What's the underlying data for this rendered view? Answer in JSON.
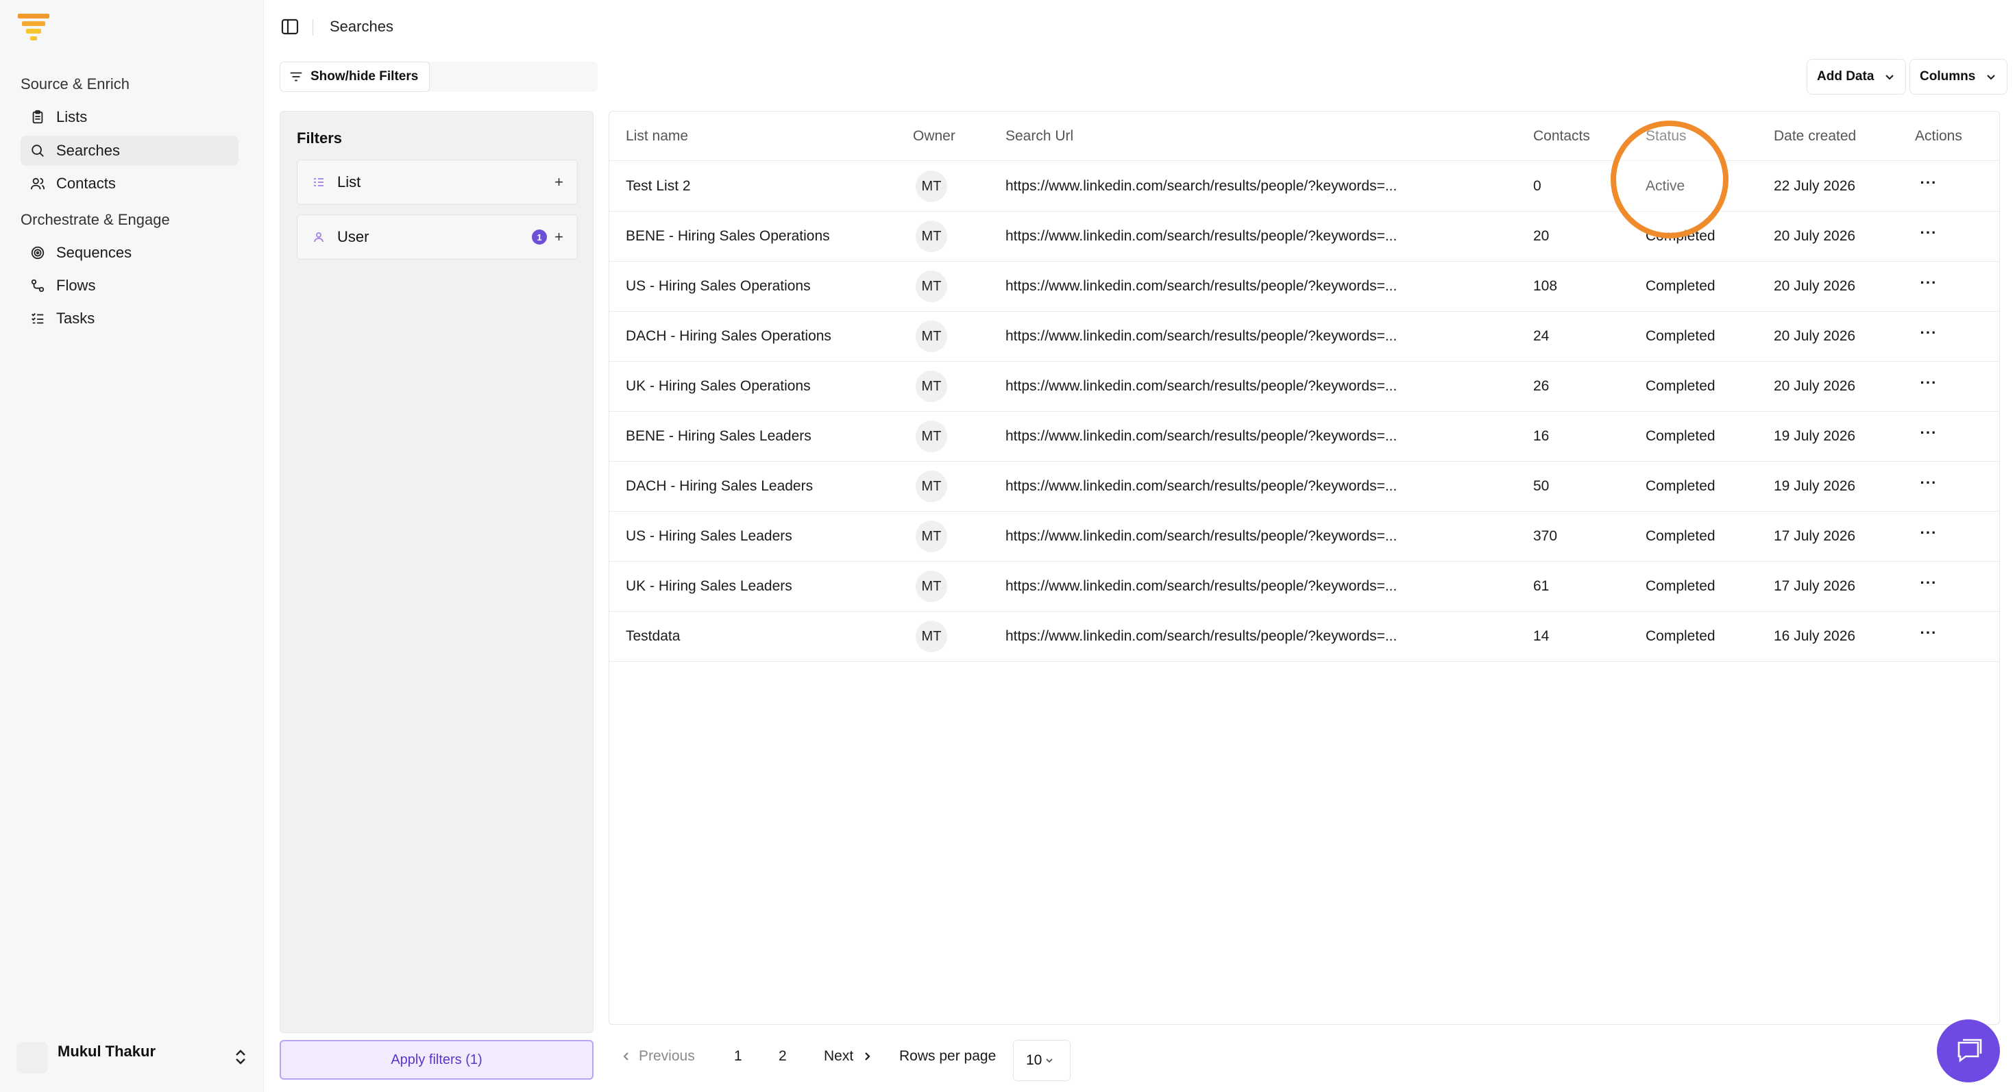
{
  "breadcrumb": {
    "title": "Searches"
  },
  "sidebar": {
    "sections": [
      {
        "title": "Source & Enrich"
      },
      {
        "title": "Orchestrate & Engage"
      }
    ],
    "items": [
      {
        "label": "Lists",
        "icon": "clipboard-icon"
      },
      {
        "label": "Searches",
        "icon": "search-icon",
        "active": true
      },
      {
        "label": "Contacts",
        "icon": "users-icon"
      },
      {
        "label": "Sequences",
        "icon": "target-icon"
      },
      {
        "label": "Flows",
        "icon": "flow-icon"
      },
      {
        "label": "Tasks",
        "icon": "tasks-icon"
      }
    ],
    "user": {
      "name": "Mukul Thakur"
    }
  },
  "toolbar": {
    "show_hide_filters": "Show/hide Filters",
    "add_data": "Add Data",
    "columns": "Columns"
  },
  "filters": {
    "title": "Filters",
    "items": [
      {
        "label": "List",
        "count": ""
      },
      {
        "label": "User",
        "count": "1"
      }
    ],
    "apply_label": "Apply filters (1)"
  },
  "table": {
    "headers": [
      "List name",
      "Owner",
      "Search Url",
      "Contacts",
      "Status",
      "Date created",
      "Actions"
    ],
    "rows": [
      {
        "name": "Test List 2",
        "owner": "MT",
        "url": "https://www.linkedin.com/search/results/people/?keywords=...",
        "contacts": "0",
        "status": "Active",
        "date": "22 July 2026"
      },
      {
        "name": "BENE - Hiring Sales Operations",
        "owner": "MT",
        "url": "https://www.linkedin.com/search/results/people/?keywords=...",
        "contacts": "20",
        "status": "Completed",
        "date": "20 July 2026"
      },
      {
        "name": "US - Hiring Sales Operations",
        "owner": "MT",
        "url": "https://www.linkedin.com/search/results/people/?keywords=...",
        "contacts": "108",
        "status": "Completed",
        "date": "20 July 2026"
      },
      {
        "name": "DACH - Hiring Sales Operations",
        "owner": "MT",
        "url": "https://www.linkedin.com/search/results/people/?keywords=...",
        "contacts": "24",
        "status": "Completed",
        "date": "20 July 2026"
      },
      {
        "name": "UK - Hiring Sales Operations",
        "owner": "MT",
        "url": "https://www.linkedin.com/search/results/people/?keywords=...",
        "contacts": "26",
        "status": "Completed",
        "date": "20 July 2026"
      },
      {
        "name": "BENE - Hiring Sales Leaders",
        "owner": "MT",
        "url": "https://www.linkedin.com/search/results/people/?keywords=...",
        "contacts": "16",
        "status": "Completed",
        "date": "19 July 2026"
      },
      {
        "name": "DACH - Hiring Sales Leaders",
        "owner": "MT",
        "url": "https://www.linkedin.com/search/results/people/?keywords=...",
        "contacts": "50",
        "status": "Completed",
        "date": "19 July 2026"
      },
      {
        "name": "US - Hiring Sales Leaders",
        "owner": "MT",
        "url": "https://www.linkedin.com/search/results/people/?keywords=...",
        "contacts": "370",
        "status": "Completed",
        "date": "17 July 2026"
      },
      {
        "name": "UK - Hiring Sales Leaders",
        "owner": "MT",
        "url": "https://www.linkedin.com/search/results/people/?keywords=...",
        "contacts": "61",
        "status": "Completed",
        "date": "17 July 2026"
      },
      {
        "name": "Testdata",
        "owner": "MT",
        "url": "https://www.linkedin.com/search/results/people/?keywords=...",
        "contacts": "14",
        "status": "Completed",
        "date": "16 July 2026"
      }
    ]
  },
  "pagination": {
    "previous": "Previous",
    "pages": [
      "1",
      "2"
    ],
    "next": "Next",
    "rows_per_page_label": "Rows per page",
    "rows_per_page_value": "10"
  },
  "colors": {
    "accent": "#6e4ae3",
    "highlight_ring": "#f08b2b",
    "logo_orange": "#f29a2e",
    "logo_yellow": "#f7c531"
  },
  "icons": {
    "chat": "chat-icon",
    "sidebar_toggle": "sidebar-toggle-icon",
    "filter": "filter-icon"
  }
}
